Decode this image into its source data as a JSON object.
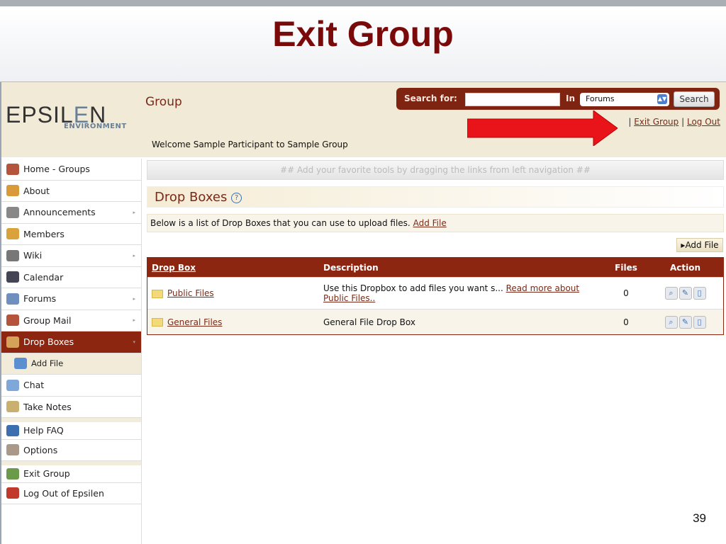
{
  "slide": {
    "title": "Exit Group",
    "page_number": "39"
  },
  "app": {
    "logo_main": "epsilen",
    "logo_sub": "ENVIRONMENT",
    "section_title": "Group",
    "welcome": "Welcome Sample Participant to Sample Group",
    "search": {
      "label": "Search for:",
      "value": "",
      "in_label": "In",
      "scope": "Forums",
      "button": "Search"
    },
    "top_links": {
      "exit_group": "Exit Group",
      "log_out": "Log Out",
      "separator": "|"
    }
  },
  "sidebar": {
    "items": [
      {
        "label": "Home - Groups",
        "icon": "home-icon"
      },
      {
        "label": "About",
        "icon": "about-icon"
      },
      {
        "label": "Announcements",
        "icon": "announcements-icon",
        "submenu": true
      },
      {
        "label": "Members",
        "icon": "members-icon"
      },
      {
        "label": "Wiki",
        "icon": "wiki-icon",
        "submenu": true
      },
      {
        "label": "Calendar",
        "icon": "calendar-icon"
      },
      {
        "label": "Forums",
        "icon": "forums-icon",
        "submenu": true
      },
      {
        "label": "Group Mail",
        "icon": "mail-icon",
        "submenu": true
      },
      {
        "label": "Drop Boxes",
        "icon": "dropbox-icon",
        "active": true
      },
      {
        "label": "Add File",
        "icon": "add-file-icon",
        "sub": true
      },
      {
        "label": "Chat",
        "icon": "chat-icon"
      },
      {
        "label": "Take Notes",
        "icon": "notes-icon"
      },
      {
        "label": "Help FAQ",
        "icon": "help-icon"
      },
      {
        "label": "Options",
        "icon": "options-icon"
      },
      {
        "label": "Exit Group",
        "icon": "exit-icon"
      },
      {
        "label": "Log Out of Epsilen",
        "icon": "logout-icon"
      }
    ]
  },
  "main": {
    "fav_hint": "## Add your favorite tools by dragging the links from left navigation ##",
    "title": "Drop Boxes",
    "help": "?",
    "description": "Below is a list of Drop Boxes that you can use to upload files.",
    "add_file_link": "Add File",
    "add_file_button": "Add File",
    "table": {
      "headers": [
        "Drop Box",
        "Description",
        "Files",
        "Action"
      ],
      "rows": [
        {
          "name": "Public Files",
          "desc": "Use this Dropbox to add files you want s...",
          "more": "Read more about Public Files..",
          "files": "0"
        },
        {
          "name": "General Files",
          "desc": "General File Drop Box",
          "more": "",
          "files": "0"
        }
      ]
    }
  },
  "colors": {
    "brand": "#8c2610",
    "title": "#7a0a0a",
    "header_bg": "#f1ead6",
    "arrow": "#e8141a"
  }
}
